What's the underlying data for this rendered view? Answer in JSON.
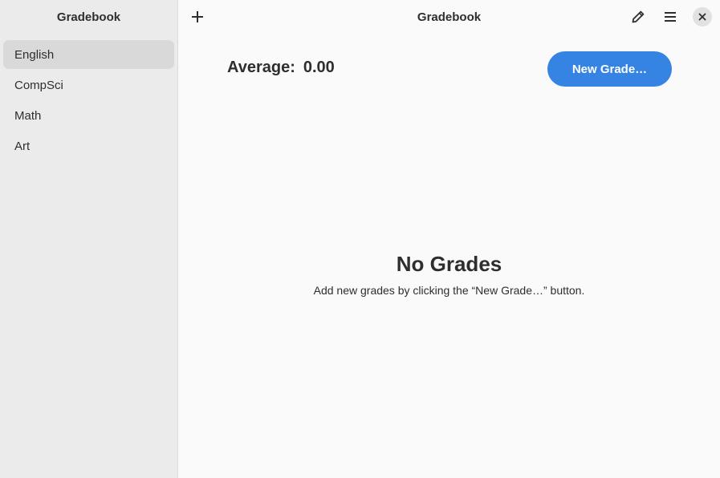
{
  "sidebar": {
    "title": "Gradebook",
    "items": [
      {
        "label": "English",
        "selected": true
      },
      {
        "label": "CompSci",
        "selected": false
      },
      {
        "label": "Math",
        "selected": false
      },
      {
        "label": "Art",
        "selected": false
      }
    ]
  },
  "header": {
    "title": "Gradebook",
    "icons": {
      "add": "plus-icon",
      "edit": "pencil-icon",
      "menu": "hamburger-menu-icon",
      "close": "close-icon"
    }
  },
  "main": {
    "average_label": "Average:",
    "average_value": "0.00",
    "new_grade_label": "New Grade…",
    "empty_title": "No Grades",
    "empty_description": "Add new grades by clicking the “New Grade…” button."
  },
  "colors": {
    "accent": "#3584e4",
    "sidebar_bg": "#ebebeb",
    "content_bg": "#fafafa",
    "selected_item": "#d9d9d9"
  }
}
